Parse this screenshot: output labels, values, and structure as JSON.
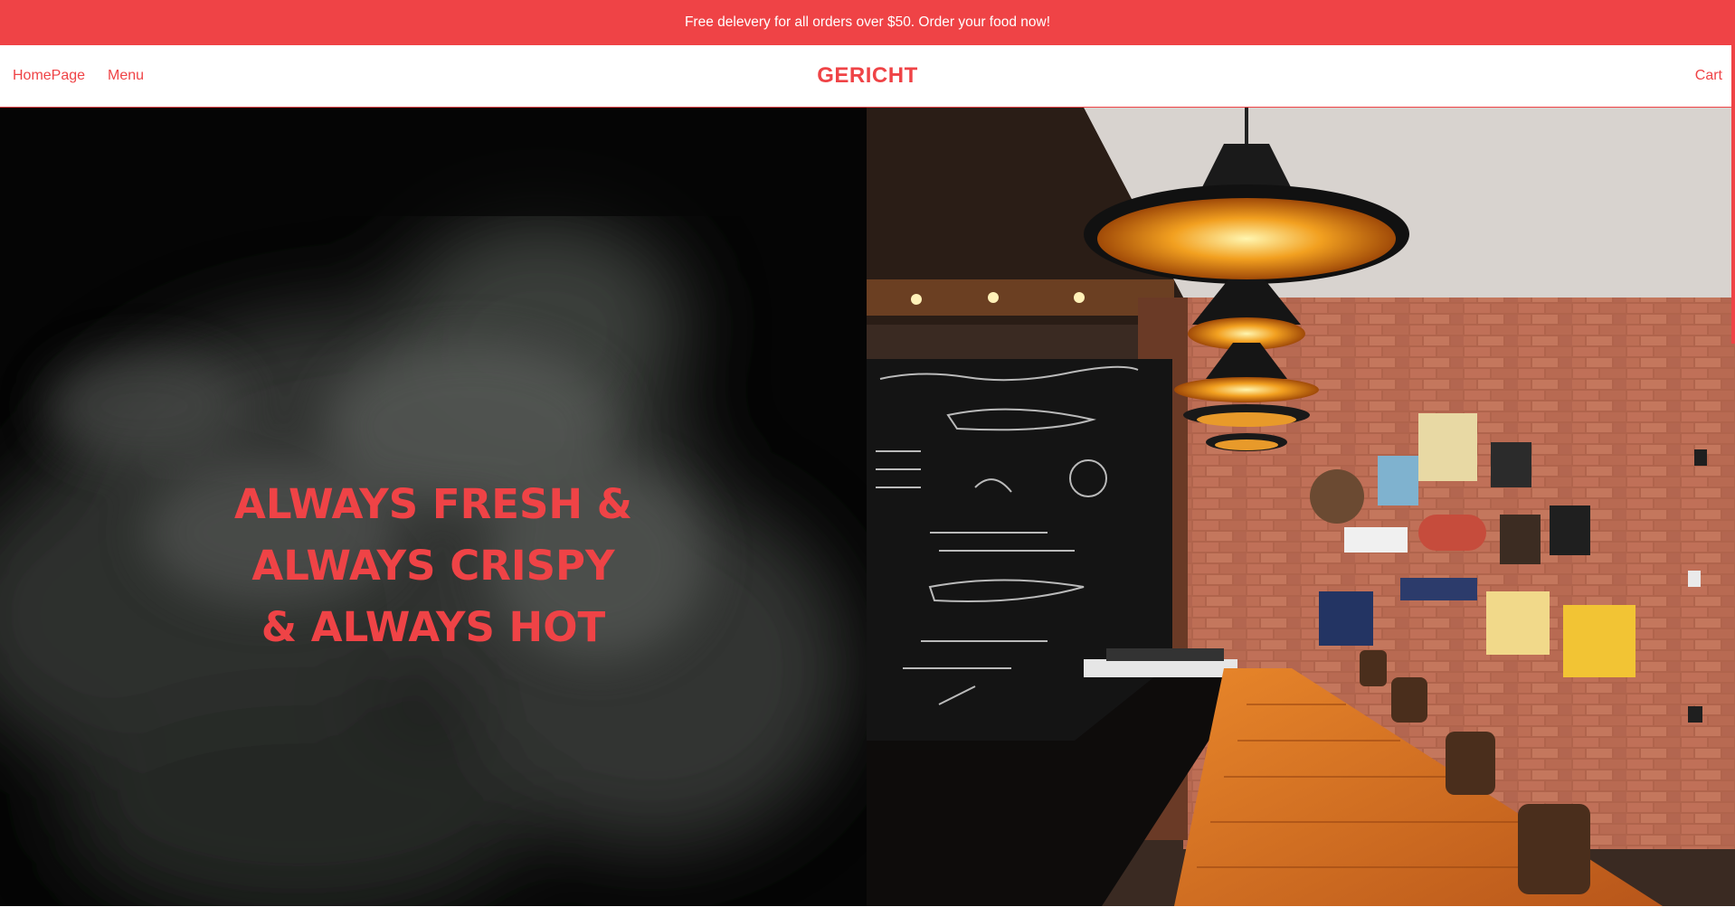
{
  "promo": {
    "text": "Free delevery for all orders over $50. Order your food now!"
  },
  "nav": {
    "home_label": "HomePage",
    "menu_label": "Menu",
    "brand": "GERICHT",
    "cart_label": "Cart"
  },
  "hero": {
    "headline_lines": [
      "ALWAYS FRESH &",
      "ALWAYS CRISPY",
      "& ALWAYS HOT"
    ],
    "left_image": "smoke-background-image",
    "right_image": "restaurant-interior-image"
  },
  "colors": {
    "accent": "#ef4346",
    "background": "#ffffff",
    "hero_dark": "#050505"
  }
}
